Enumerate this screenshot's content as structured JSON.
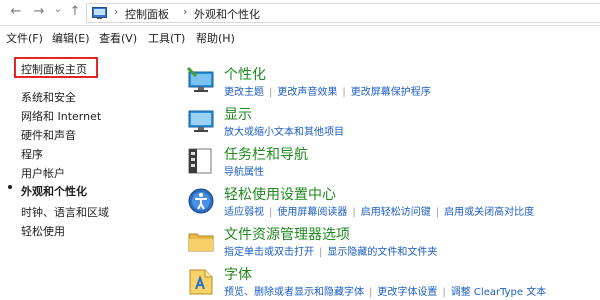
{
  "address_bar": {
    "back_arrow": "←",
    "forward_arrow": "→",
    "dropdown": "⌄",
    "up_arrow": "↑",
    "crumbs": [
      "控制面板",
      "外观和个性化"
    ],
    "separator": "›"
  },
  "menu": [
    "文件(F)",
    "编辑(E)",
    "查看(V)",
    "工具(T)",
    "帮助(H)"
  ],
  "sidebar": {
    "home": "控制面板主页",
    "items": [
      "系统和安全",
      "网络和 Internet",
      "硬件和声音",
      "程序",
      "用户帐户",
      "外观和个性化",
      "时钟、语言和区域",
      "轻松使用"
    ]
  },
  "categories": [
    {
      "title": "个性化",
      "links": [
        "更改主题",
        "更改声音效果",
        "更改屏幕保护程序"
      ]
    },
    {
      "title": "显示",
      "links": [
        "放大或缩小文本和其他项目"
      ]
    },
    {
      "title": "任务栏和导航",
      "links": [
        "导航属性"
      ]
    },
    {
      "title": "轻松使用设置中心",
      "links": [
        "适应弱视",
        "使用屏幕阅读器",
        "启用轻松访问键",
        "启用或关闭高对比度"
      ]
    },
    {
      "title": "文件资源管理器选项",
      "links": [
        "指定单击或双击打开",
        "显示隐藏的文件和文件夹"
      ]
    },
    {
      "title": "字体",
      "links": [
        "预览、删除或者显示和隐藏字体",
        "更改字体设置",
        "调整 ClearType 文本"
      ]
    }
  ],
  "colors": {
    "category_title": "#228822",
    "link": "#1d5ec5",
    "highlight_border": "#e5242a"
  }
}
